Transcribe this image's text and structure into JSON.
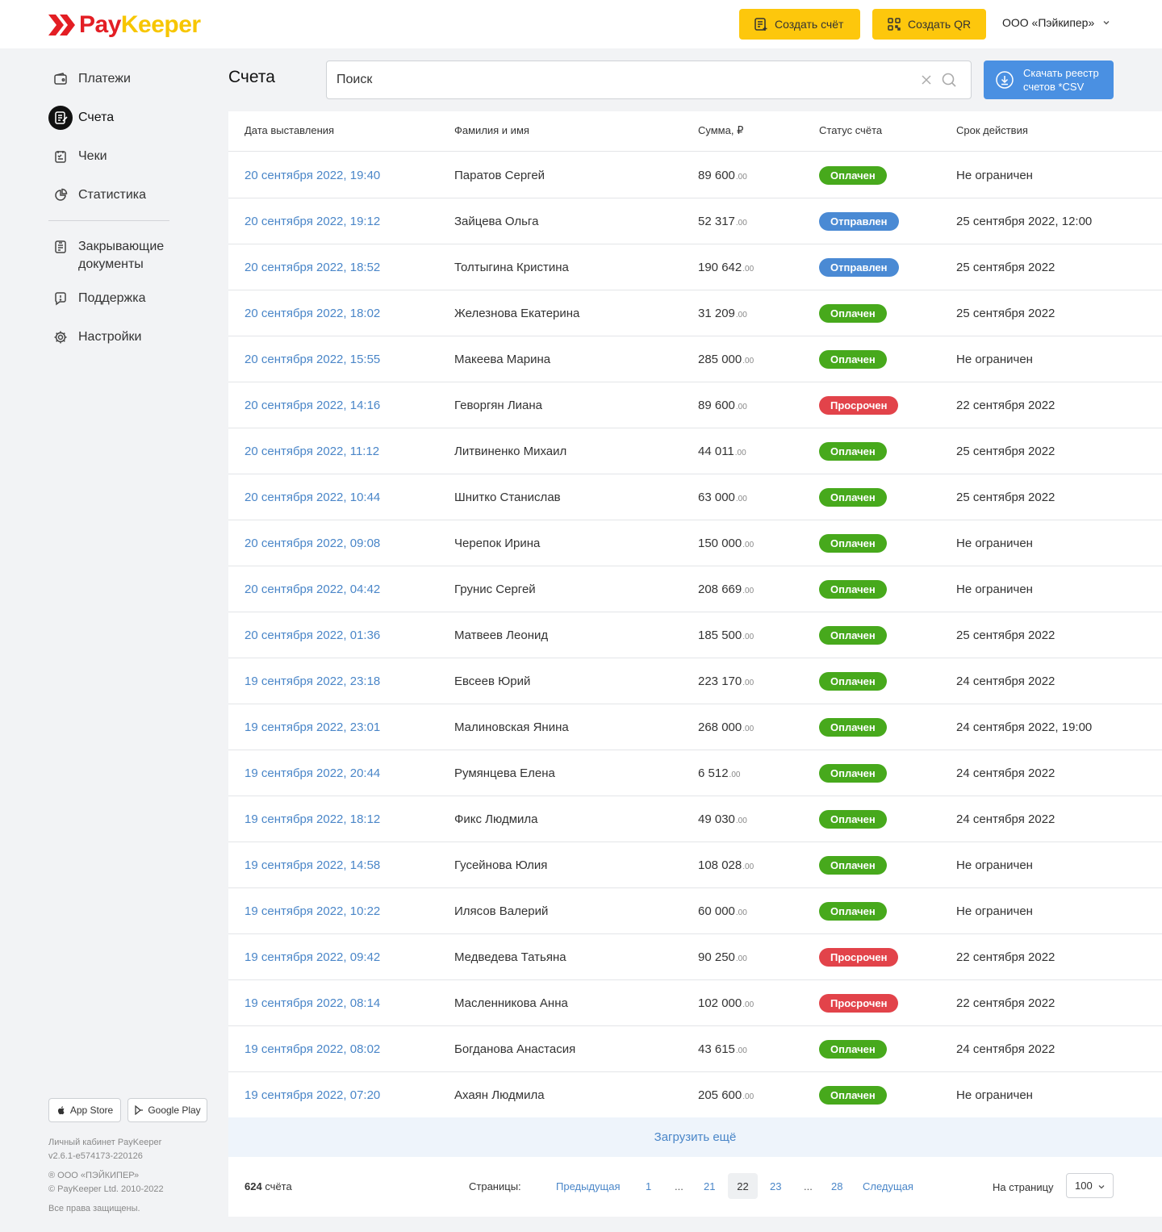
{
  "brand": {
    "logo_left": "Pay",
    "logo_right": "Keeper",
    "red": "#e31e24",
    "yellow": "#f7c600"
  },
  "header": {
    "create_invoice": "Создать счёт",
    "create_qr": "Создать QR",
    "org": "ООО «Пэйкипер»",
    "button_color": "#fdc70c"
  },
  "sidebar": {
    "items": [
      {
        "label": "Платежи",
        "icon": "wallet-icon"
      },
      {
        "label": "Счета",
        "icon": "invoice-icon",
        "active": true
      },
      {
        "label": "Чеки",
        "icon": "receipt-icon"
      },
      {
        "label": "Статистика",
        "icon": "pie-chart-icon"
      }
    ],
    "items2": [
      {
        "label": "Закрывающие документы",
        "icon": "documents-icon"
      },
      {
        "label": "Поддержка",
        "icon": "support-chat-icon"
      },
      {
        "label": "Настройки",
        "icon": "gear-icon"
      }
    ],
    "app_store": "App Store",
    "google_play": "Google Play",
    "footer": {
      "line1": "Личный кабинет PayKeeper",
      "line2": "v2.6.1-e574173-220126",
      "line3": "® ООО «ПЭЙКИПЕР»",
      "line4": "© PayKeeper Ltd. 2010-2022",
      "line5": "Все права защищены."
    }
  },
  "main": {
    "title": "Счета",
    "search_placeholder": "Поиск",
    "csv_line1": "Скачать реестр",
    "csv_line2": "счетов *CSV",
    "csv_color": "#4a90e2"
  },
  "table": {
    "columns": [
      "Дата выставления",
      "Фамилия и имя",
      "Сумма, ₽",
      "Статус счёта",
      "Срок действия"
    ],
    "rows": [
      {
        "date": "20 сентября 2022, 19:40",
        "name": "Паратов Сергей",
        "sum": "89 600",
        "kop": ".00",
        "status": "Оплачен",
        "kind": "paid",
        "term": "Не ограничен"
      },
      {
        "date": "20 сентября 2022, 19:12",
        "name": "Зайцева Ольга",
        "sum": "52 317",
        "kop": ".00",
        "status": "Отправлен",
        "kind": "sent",
        "term": "25 сентября 2022, 12:00"
      },
      {
        "date": "20 сентября 2022, 18:52",
        "name": "Толтыгина Кристина",
        "sum": "190 642",
        "kop": ".00",
        "status": "Отправлен",
        "kind": "sent",
        "term": "25 сентября 2022"
      },
      {
        "date": "20 сентября 2022, 18:02",
        "name": "Железнова Екатерина",
        "sum": "31 209",
        "kop": ".00",
        "status": "Оплачен",
        "kind": "paid",
        "term": "25 сентября 2022"
      },
      {
        "date": "20 сентября 2022, 15:55",
        "name": "Макеева Марина",
        "sum": "285 000",
        "kop": ".00",
        "status": "Оплачен",
        "kind": "paid",
        "term": "Не ограничен"
      },
      {
        "date": "20 сентября 2022, 14:16",
        "name": "Геворгян Лиана",
        "sum": "89 600",
        "kop": ".00",
        "status": "Просрочен",
        "kind": "overdue",
        "term": "22 сентября 2022"
      },
      {
        "date": "20 сентября 2022, 11:12",
        "name": "Литвиненко Михаил",
        "sum": "44 011",
        "kop": ".00",
        "status": "Оплачен",
        "kind": "paid",
        "term": "25 сентября 2022"
      },
      {
        "date": "20 сентября 2022, 10:44",
        "name": "Шнитко Станислав",
        "sum": "63 000",
        "kop": ".00",
        "status": "Оплачен",
        "kind": "paid",
        "term": "25 сентября 2022"
      },
      {
        "date": "20 сентября 2022, 09:08",
        "name": "Черепок Ирина",
        "sum": "150 000",
        "kop": ".00",
        "status": "Оплачен",
        "kind": "paid",
        "term": "Не ограничен"
      },
      {
        "date": "20 сентября 2022, 04:42",
        "name": "Грунис Сергей",
        "sum": "208 669",
        "kop": ".00",
        "status": "Оплачен",
        "kind": "paid",
        "term": "Не ограничен"
      },
      {
        "date": "20 сентября 2022, 01:36",
        "name": "Матвеев Леонид",
        "sum": "185 500",
        "kop": ".00",
        "status": "Оплачен",
        "kind": "paid",
        "term": "25 сентября 2022"
      },
      {
        "date": "19 сентября 2022, 23:18",
        "name": "Евсеев Юрий",
        "sum": "223 170",
        "kop": ".00",
        "status": "Оплачен",
        "kind": "paid",
        "term": "24 сентября 2022"
      },
      {
        "date": "19 сентября 2022, 23:01",
        "name": "Малиновская Янина",
        "sum": "268 000",
        "kop": ".00",
        "status": "Оплачен",
        "kind": "paid",
        "term": "24 сентября 2022, 19:00"
      },
      {
        "date": "19 сентября 2022, 20:44",
        "name": "Румянцева Елена",
        "sum": "6 512",
        "kop": ".00",
        "status": "Оплачен",
        "kind": "paid",
        "term": "24 сентября 2022"
      },
      {
        "date": "19 сентября 2022, 18:12",
        "name": "Фикс Людмила",
        "sum": "49 030",
        "kop": ".00",
        "status": "Оплачен",
        "kind": "paid",
        "term": "24 сентября 2022"
      },
      {
        "date": "19 сентября 2022, 14:58",
        "name": "Гусейнова Юлия",
        "sum": "108 028",
        "kop": ".00",
        "status": "Оплачен",
        "kind": "paid",
        "term": "Не ограничен"
      },
      {
        "date": "19 сентября 2022, 10:22",
        "name": "Илясов Валерий",
        "sum": "60 000",
        "kop": ".00",
        "status": "Оплачен",
        "kind": "paid",
        "term": "Не ограничен"
      },
      {
        "date": "19 сентября 2022, 09:42",
        "name": "Медведева Татьяна",
        "sum": "90 250",
        "kop": ".00",
        "status": "Просрочен",
        "kind": "overdue",
        "term": "22 сентября 2022"
      },
      {
        "date": "19 сентября 2022, 08:14",
        "name": "Масленникова Анна",
        "sum": "102 000",
        "kop": ".00",
        "status": "Просрочен",
        "kind": "overdue",
        "term": "22 сентября 2022"
      },
      {
        "date": "19 сентября 2022, 08:02",
        "name": "Богданова Анастасия",
        "sum": "43 615",
        "kop": ".00",
        "status": "Оплачен",
        "kind": "paid",
        "term": "24 сентября 2022"
      },
      {
        "date": "19 сентября 2022, 07:20",
        "name": "Ахаян Людмила",
        "sum": "205 600",
        "kop": ".00",
        "status": "Оплачен",
        "kind": "paid",
        "term": "Не ограничен"
      }
    ],
    "status_colors": {
      "paid": "#47a91c",
      "sent": "#4a8ad4",
      "overdue": "#e2434a"
    },
    "load_more": "Загрузить ещё"
  },
  "pager": {
    "count_num": "624",
    "count_word": "счёта",
    "pages_label": "Страницы:",
    "prev": "Предыдущая",
    "p1": "1",
    "dots": "...",
    "p21": "21",
    "current": "22",
    "p23": "23",
    "p28": "28",
    "next": "Следущая",
    "per_page_label": "На страницу",
    "per_page_value": "100"
  }
}
